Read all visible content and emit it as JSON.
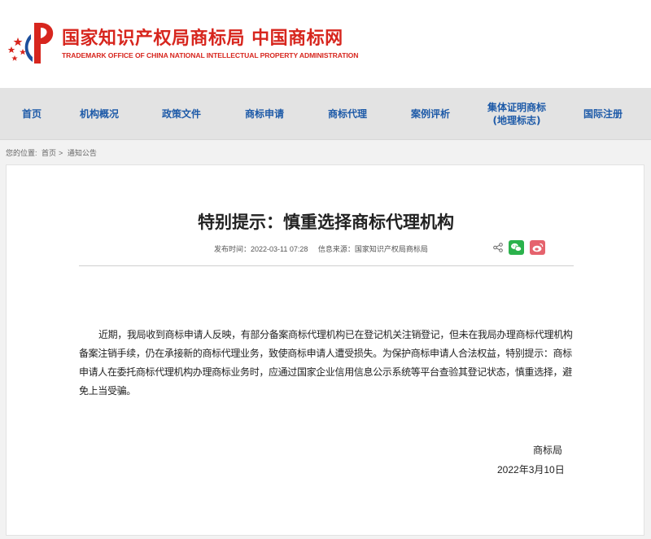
{
  "header": {
    "title": "国家知识产权局商标局 中国商标网",
    "subtitle": "TRADEMARK OFFICE OF CHINA NATIONAL INTELLECTUAL PROPERTY ADMINISTRATION",
    "logo_icon": "cnipa-logo-icon",
    "brand_color": "#d7261e"
  },
  "nav": {
    "items": [
      {
        "label": "首页"
      },
      {
        "label": "机构概况"
      },
      {
        "label": "政策文件"
      },
      {
        "label": "商标申请"
      },
      {
        "label": "商标代理"
      },
      {
        "label": "案例评析"
      },
      {
        "label": "集体证明商标\n(地理标志)"
      },
      {
        "label": "国际注册"
      }
    ],
    "color": "#1d5aa8"
  },
  "breadcrumb": {
    "prefix": "您的位置:",
    "home": "首页",
    "separator": ">",
    "current": "通知公告"
  },
  "article": {
    "title": "特别提示：慎重选择商标代理机构",
    "publish_time": "发布时间：2022-03-11 07:28",
    "source": "信息来源：国家知识产权局商标局",
    "share_icons": [
      "share-icon",
      "wechat-icon",
      "weibo-icon"
    ],
    "body": "近期，我局收到商标申请人反映，有部分备案商标代理机构已在登记机关注销登记，但未在我局办理商标代理机构备案注销手续，仍在承接新的商标代理业务，致使商标申请人遭受损失。为保护商标申请人合法权益，特别提示：商标申请人在委托商标代理机构办理商标业务时，应通过国家企业信用信息公示系统等平台查验其登记状态，慎重选择，避免上当受骗。",
    "signature_org": "商标局",
    "signature_date": "2022年3月10日"
  }
}
